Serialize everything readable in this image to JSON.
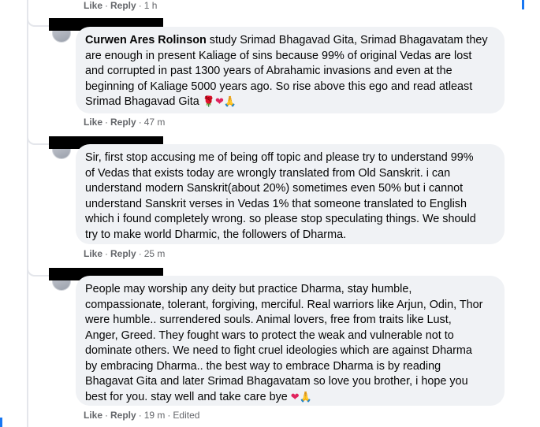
{
  "top_actions": {
    "like": "Like",
    "reply": "Reply",
    "time": "1 h"
  },
  "comments": [
    {
      "author": "Curwen Ares Rolinson",
      "text": " study Srimad Bhagavad Gita, Srimad Bhagavatam they\nare enough in present Kaliage of sins because 99% of original Vedas are lost\nand corrupted in past 1300 years of Abrahamic invasions and even at the\nbeginning of Kaliage 5000 years ago. So rise above this ego and read atleast\nSrimad Bhagavad Gita ",
      "emojis": [
        "🌹",
        "❤",
        "🙏"
      ],
      "like": "Like",
      "reply": "Reply",
      "time": "47 m",
      "edited": ""
    },
    {
      "author": "",
      "text": "Sir, first stop accusing me of being off topic and please try to understand 99%\nof Vedas that exists today are wrongly translated from Old Sanskrit. i can\nunderstand modern Sanskrit(about 20%) sometimes even 50% but i cannot\nunderstand Sanskrit verses in Vedas 1% that someone translated to English\nwhich i found completely wrong. so please stop speculating things. We should\ntry to make world Dharmic, the followers of Dharma.",
      "emojis": [],
      "like": "Like",
      "reply": "Reply",
      "time": "25 m",
      "edited": ""
    },
    {
      "author": "",
      "text": "People may worship any deity but practice Dharma, stay humble,\ncompassionate, tolerant, forgiving, merciful. Real warriors like Arjun, Odin, Thor\nwere humble.. surrendered souls. Animal lovers, free from traits like Lust,\nAnger, Greed. They fought wars to protect the weak and vulnerable not to\ndominate others. We need to fight cruel ideologies which are against Dharma\nby embracing Dharma.. the best way to embrace Dharma is by reading\nBhagavat Gita and later Srimad Bhagavatam so love you brother, i hope you\nbest for you. stay well and take care bye ",
      "emojis": [
        "❤",
        "🙏"
      ],
      "like": "Like",
      "reply": "Reply",
      "time": "19 m",
      "edited": "Edited"
    }
  ]
}
